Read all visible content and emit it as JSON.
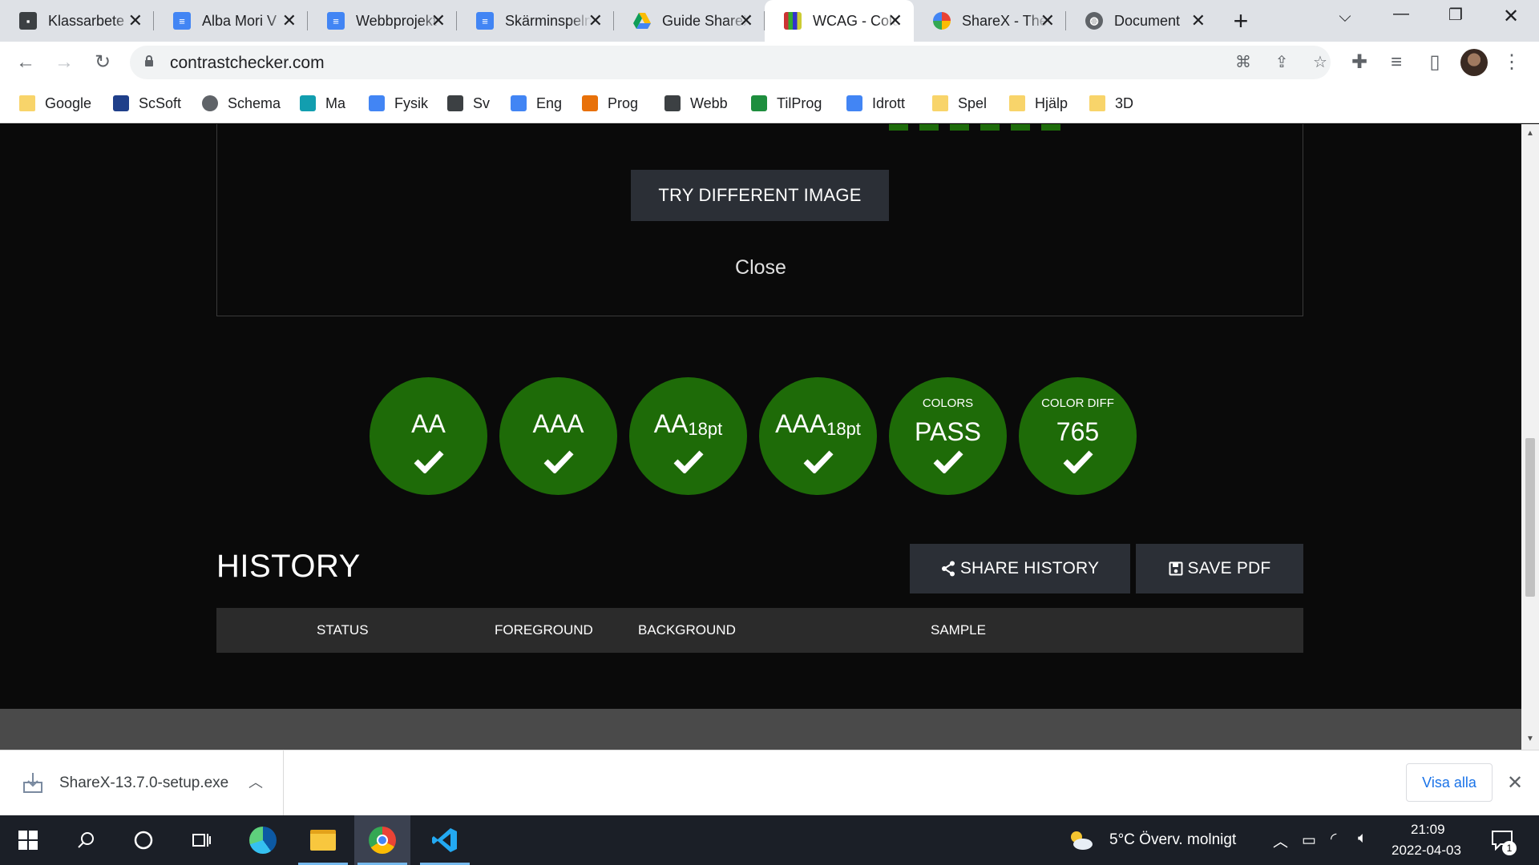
{
  "browser": {
    "tabs": [
      {
        "title": "Klassarbete",
        "icon": "classroom-icon",
        "color": "#3c4043"
      },
      {
        "title": "Alba Mori V",
        "icon": "docs-icon",
        "color": "#4285f4"
      },
      {
        "title": "Webbprojekt",
        "icon": "docs-icon",
        "color": "#4285f4"
      },
      {
        "title": "Skärminspelning",
        "icon": "docs-icon",
        "color": "#4285f4"
      },
      {
        "title": "Guide ShareX",
        "icon": "drive-icon",
        "color": "#0f9d58"
      },
      {
        "title": "WCAG - Color Contrast Checker",
        "icon": "wcag-icon",
        "color": "#444444",
        "active": true
      },
      {
        "title": "ShareX - The best",
        "icon": "sharex-icon",
        "color": "#1a73e8"
      },
      {
        "title": "Document",
        "icon": "globe-icon",
        "color": "#5f6368"
      }
    ],
    "url": "contrastchecker.com",
    "bookmarks": [
      {
        "label": "Google",
        "icon": "folder-icon"
      },
      {
        "label": "ScSoft",
        "icon": "scsoft-icon",
        "color": "#1f3f8a"
      },
      {
        "label": "Schema",
        "icon": "globe-icon",
        "color": "#5f6368"
      },
      {
        "label": "Ma",
        "icon": "classroom-icon",
        "color": "#129eaf"
      },
      {
        "label": "Fysik",
        "icon": "classroom-icon",
        "color": "#4285f4"
      },
      {
        "label": "Sv",
        "icon": "classroom-icon",
        "color": "#3c4043"
      },
      {
        "label": "Eng",
        "icon": "classroom-icon",
        "color": "#4285f4"
      },
      {
        "label": "Prog",
        "icon": "classroom-icon",
        "color": "#e8710a"
      },
      {
        "label": "Webb",
        "icon": "classroom-icon",
        "color": "#3c4043"
      },
      {
        "label": "TilProg",
        "icon": "classroom-icon",
        "color": "#1e8e3e"
      },
      {
        "label": "Idrott",
        "icon": "classroom-icon",
        "color": "#4285f4"
      },
      {
        "label": "Spel",
        "icon": "folder-icon"
      },
      {
        "label": "Hjälp",
        "icon": "folder-icon"
      },
      {
        "label": "3D",
        "icon": "folder-icon"
      }
    ]
  },
  "page": {
    "try_button": "TRY DIFFERENT IMAGE",
    "close_link": "Close",
    "accent": "#1e6b08",
    "badges": [
      {
        "small": "",
        "main": "AA",
        "sub": ""
      },
      {
        "small": "",
        "main": "AAA",
        "sub": ""
      },
      {
        "small": "",
        "main": "AA",
        "sub": "18pt"
      },
      {
        "small": "",
        "main": "AAA",
        "sub": "18pt"
      },
      {
        "small": "COLORS",
        "main": "PASS",
        "sub": ""
      },
      {
        "small": "COLOR DIFF",
        "main": "765",
        "sub": ""
      }
    ],
    "history": {
      "title": "HISTORY",
      "share_button": "SHARE HISTORY",
      "save_button": "SAVE PDF",
      "columns": [
        "STATUS",
        "FOREGROUND",
        "BACKGROUND",
        "SAMPLE"
      ]
    }
  },
  "downloads": {
    "file": "ShareX-13.7.0-setup.exe",
    "show_all": "Visa alla"
  },
  "taskbar": {
    "weather": "5°C  Överv. molnigt",
    "time": "21:09",
    "date": "2022-04-03",
    "notifications": "1"
  }
}
